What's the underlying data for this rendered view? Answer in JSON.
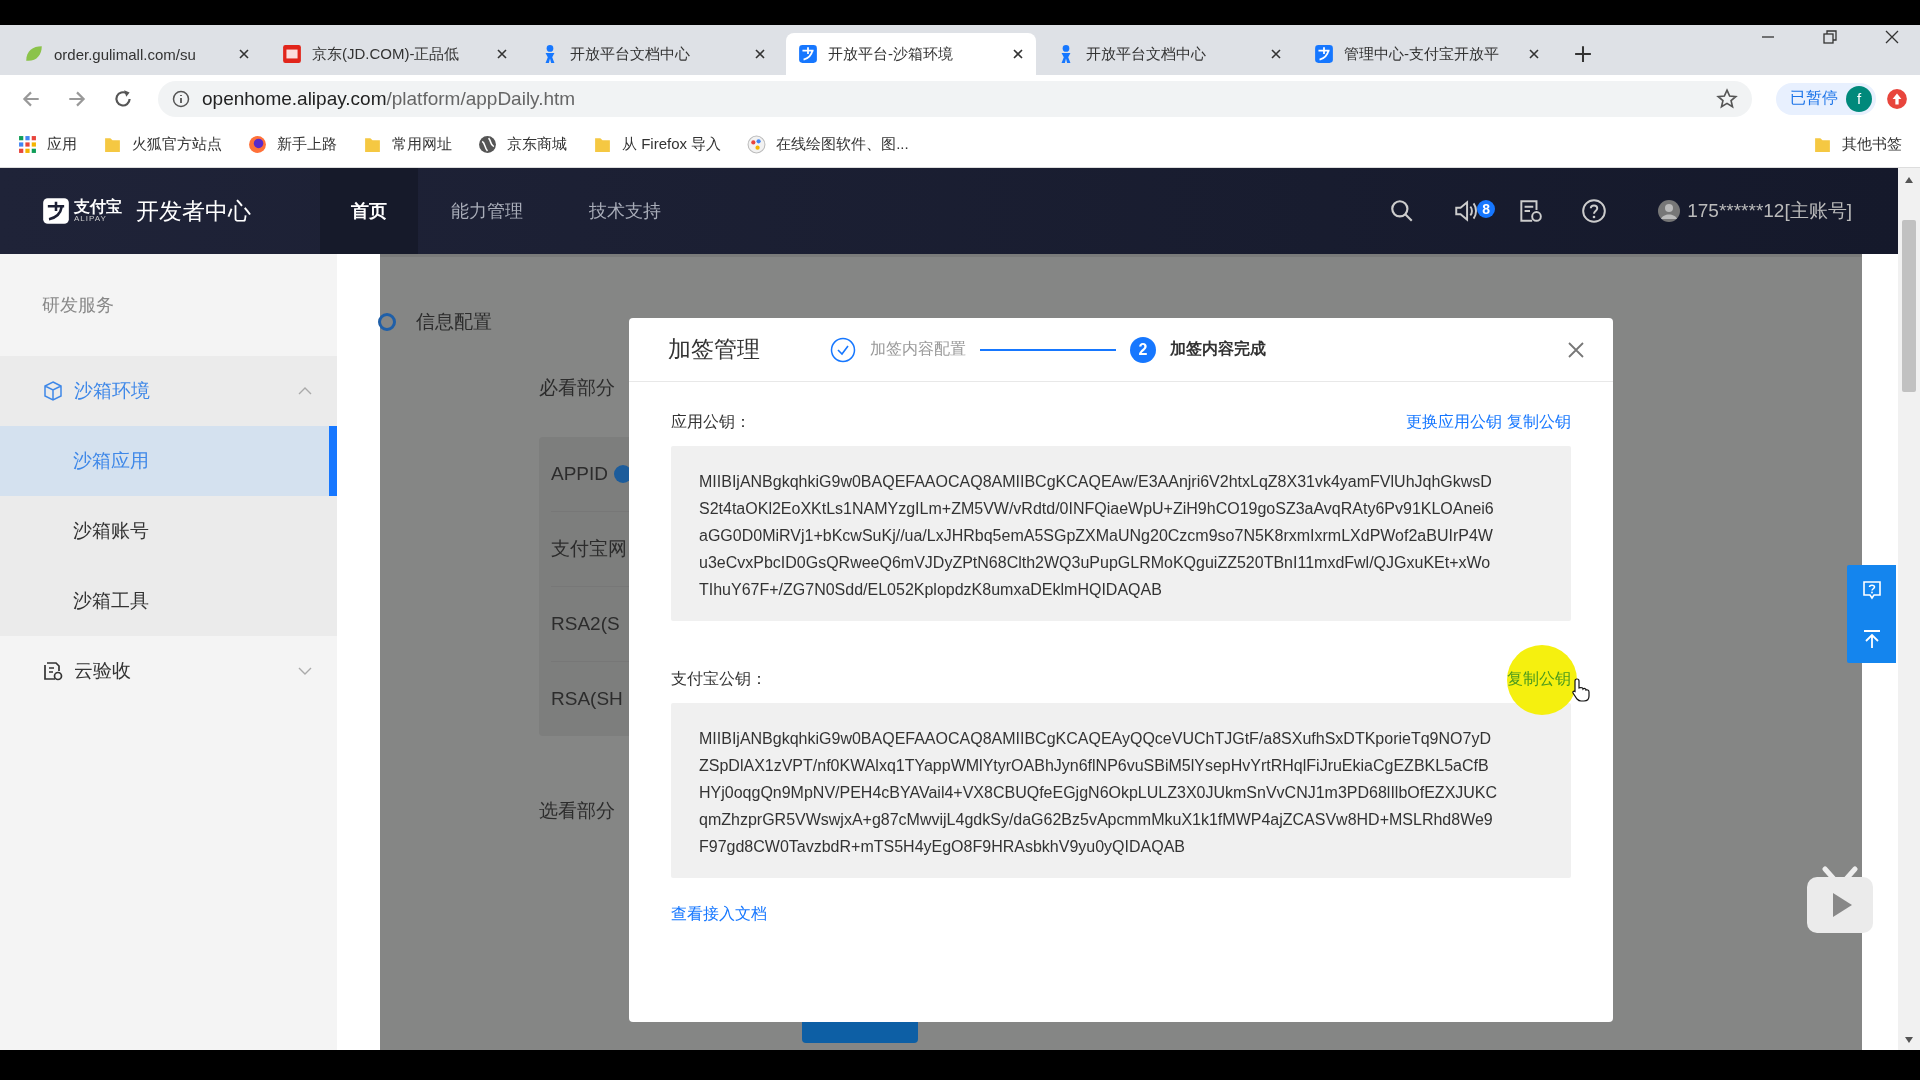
{
  "browser": {
    "tabs": [
      {
        "title": "order.gulimall.com/su",
        "kind": "leaf",
        "selected": false
      },
      {
        "title": "京东(JD.COM)-正品低",
        "kind": "shop",
        "selected": false
      },
      {
        "title": "开放平台文档中心",
        "kind": "figure",
        "selected": false
      },
      {
        "title": "开放平台-沙箱环境",
        "kind": "app",
        "selected": true
      },
      {
        "title": "开放平台文档中心",
        "kind": "figure",
        "selected": false
      },
      {
        "title": "管理中心-支付宝开放平",
        "kind": "app",
        "selected": false
      }
    ],
    "address": {
      "host": "openhome.alipay.com",
      "path": "/platform/appDaily.htm"
    },
    "profile": {
      "status": "已暂停",
      "initial": "f"
    },
    "bookmarks": [
      {
        "label": "应用",
        "kind": "apps"
      },
      {
        "label": "火狐官方站点",
        "kind": "folder"
      },
      {
        "label": "新手上路",
        "kind": "browser"
      },
      {
        "label": "常用网址",
        "kind": "folder"
      },
      {
        "label": "京东商城",
        "kind": "globe"
      },
      {
        "label": "从 Firefox 导入",
        "kind": "folder"
      },
      {
        "label": "在线绘图软件、图...",
        "kind": "palette"
      }
    ],
    "other_bookmarks": "其他书签"
  },
  "header": {
    "logo_cn": "支付宝",
    "logo_en": "ALIPAY",
    "title": "开发者中心",
    "nav": [
      {
        "label": "首页",
        "selected": true
      },
      {
        "label": "能力管理",
        "selected": false
      },
      {
        "label": "技术支持",
        "selected": false
      }
    ],
    "notification_count": "8",
    "account": "175******12[主账号]"
  },
  "sidebar": {
    "section": "研发服务",
    "groups": [
      {
        "label": "沙箱环境",
        "kind": "cube",
        "expanded": true,
        "children": [
          {
            "label": "沙箱应用",
            "selected": true
          },
          {
            "label": "沙箱账号",
            "selected": false
          },
          {
            "label": "沙箱工具",
            "selected": false
          }
        ]
      },
      {
        "label": "云验收",
        "kind": "report",
        "expanded": false
      }
    ]
  },
  "page": {
    "step": "信息配置",
    "required": "必看部分",
    "rows": [
      "APPID",
      "支付宝网",
      "RSA2(S",
      "RSA(SH"
    ],
    "optional": "选看部分"
  },
  "modal": {
    "title": "加签管理",
    "steps": [
      {
        "kind": "done",
        "label": "加签内容配置"
      },
      {
        "kind": "current",
        "number": "2",
        "label": "加签内容完成"
      }
    ],
    "sections": [
      {
        "label": "应用公钥：",
        "actions": [
          {
            "label": "更换应用公钥",
            "highlighted": false
          },
          {
            "label": "复制公钥",
            "highlighted": false
          }
        ],
        "key_lines": [
          "MIIBIjANBgkqhkiG9w0BAQEFAAOCAQ8AMIIBCgKCAQEAw/E3AAnjri6V2htxLqZ8X31vk4yamFVlUhJqhGkwsD",
          "S2t4taOKl2EoXKtLs1NAMYzgILm+ZM5VW/vRdtd/0INFQiaeWpU+ZiH9hCO19goSZ3aAvqRAty6Pv91KLOAnei6",
          "aGG0D0MiRVj1+bKcwSuKj//ua/LxJHRbq5emA5SGpZXMaUNg20Czcm9so7N5K8rxmIxrmLXdPWof2aBUIrP4W",
          "u3eCvxPbcID0GsQRweeQ6mVJDyZPtN68Clth2WQ3uPupGLRMoKQguiZZ520TBnI11mxdFwl/QJGxuKEt+xWo",
          "TIhuY67F+/ZG7N0Sdd/EL052KplopdzK8umxaDEklmHQIDAQAB"
        ]
      },
      {
        "label": "支付宝公钥：",
        "actions": [
          {
            "label": "复制公钥",
            "highlighted": true
          }
        ],
        "key_lines": [
          "MIIBIjANBgkqhkiG9w0BAQEFAAOCAQ8AMIIBCgKCAQEAyQQceVUChTJGtF/a8SXufhSxDTKporieTq9NO7yD",
          "ZSpDlAX1zVPT/nf0KWAlxq1TYappWMlYtyrOABhJyn6flNP6vuSBiM5lYsepHvYrtRHqlFiJruEkiaCgEZBKL5aCfB",
          "HYj0oqgQn9MpNV/PEH4cBYAVail4+VX8CBUQfeEGjgN6OkpLULZ3X0JUkmSnVvCNJ1m3PD68lIlbOfEZXJUKC",
          "qmZhzprGR5VWswjxA+g87cMwvijL4gdkSy/daG62Bz5vApcmmMkuX1k1fMWP4ajZCASVw8HD+MSLRhd8We9",
          "F97gd8CW0TavzbdR+mTS5H4yEgO8F9HRAsbkhV9yu0yQIDAQAB"
        ]
      }
    ],
    "doc_link": "查看接入文档"
  }
}
